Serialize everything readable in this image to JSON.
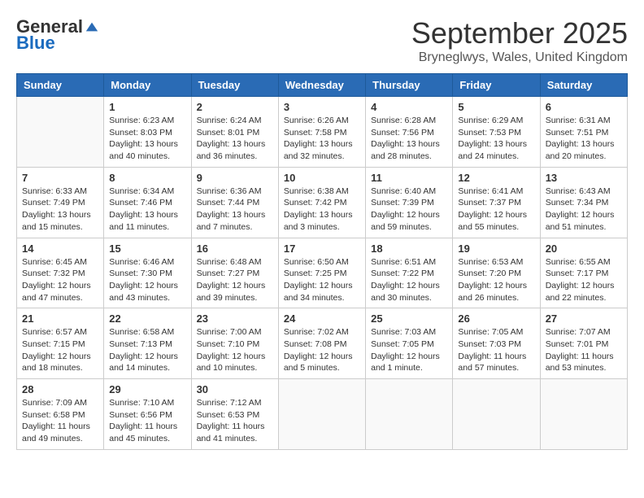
{
  "header": {
    "logo": {
      "general": "General",
      "blue": "Blue"
    },
    "title": "September 2025",
    "location": "Bryneglwys, Wales, United Kingdom"
  },
  "days_of_week": [
    "Sunday",
    "Monday",
    "Tuesday",
    "Wednesday",
    "Thursday",
    "Friday",
    "Saturday"
  ],
  "weeks": [
    [
      {
        "day": "",
        "sunrise": "",
        "sunset": "",
        "daylight": ""
      },
      {
        "day": "1",
        "sunrise": "Sunrise: 6:23 AM",
        "sunset": "Sunset: 8:03 PM",
        "daylight": "Daylight: 13 hours and 40 minutes."
      },
      {
        "day": "2",
        "sunrise": "Sunrise: 6:24 AM",
        "sunset": "Sunset: 8:01 PM",
        "daylight": "Daylight: 13 hours and 36 minutes."
      },
      {
        "day": "3",
        "sunrise": "Sunrise: 6:26 AM",
        "sunset": "Sunset: 7:58 PM",
        "daylight": "Daylight: 13 hours and 32 minutes."
      },
      {
        "day": "4",
        "sunrise": "Sunrise: 6:28 AM",
        "sunset": "Sunset: 7:56 PM",
        "daylight": "Daylight: 13 hours and 28 minutes."
      },
      {
        "day": "5",
        "sunrise": "Sunrise: 6:29 AM",
        "sunset": "Sunset: 7:53 PM",
        "daylight": "Daylight: 13 hours and 24 minutes."
      },
      {
        "day": "6",
        "sunrise": "Sunrise: 6:31 AM",
        "sunset": "Sunset: 7:51 PM",
        "daylight": "Daylight: 13 hours and 20 minutes."
      }
    ],
    [
      {
        "day": "7",
        "sunrise": "Sunrise: 6:33 AM",
        "sunset": "Sunset: 7:49 PM",
        "daylight": "Daylight: 13 hours and 15 minutes."
      },
      {
        "day": "8",
        "sunrise": "Sunrise: 6:34 AM",
        "sunset": "Sunset: 7:46 PM",
        "daylight": "Daylight: 13 hours and 11 minutes."
      },
      {
        "day": "9",
        "sunrise": "Sunrise: 6:36 AM",
        "sunset": "Sunset: 7:44 PM",
        "daylight": "Daylight: 13 hours and 7 minutes."
      },
      {
        "day": "10",
        "sunrise": "Sunrise: 6:38 AM",
        "sunset": "Sunset: 7:42 PM",
        "daylight": "Daylight: 13 hours and 3 minutes."
      },
      {
        "day": "11",
        "sunrise": "Sunrise: 6:40 AM",
        "sunset": "Sunset: 7:39 PM",
        "daylight": "Daylight: 12 hours and 59 minutes."
      },
      {
        "day": "12",
        "sunrise": "Sunrise: 6:41 AM",
        "sunset": "Sunset: 7:37 PM",
        "daylight": "Daylight: 12 hours and 55 minutes."
      },
      {
        "day": "13",
        "sunrise": "Sunrise: 6:43 AM",
        "sunset": "Sunset: 7:34 PM",
        "daylight": "Daylight: 12 hours and 51 minutes."
      }
    ],
    [
      {
        "day": "14",
        "sunrise": "Sunrise: 6:45 AM",
        "sunset": "Sunset: 7:32 PM",
        "daylight": "Daylight: 12 hours and 47 minutes."
      },
      {
        "day": "15",
        "sunrise": "Sunrise: 6:46 AM",
        "sunset": "Sunset: 7:30 PM",
        "daylight": "Daylight: 12 hours and 43 minutes."
      },
      {
        "day": "16",
        "sunrise": "Sunrise: 6:48 AM",
        "sunset": "Sunset: 7:27 PM",
        "daylight": "Daylight: 12 hours and 39 minutes."
      },
      {
        "day": "17",
        "sunrise": "Sunrise: 6:50 AM",
        "sunset": "Sunset: 7:25 PM",
        "daylight": "Daylight: 12 hours and 34 minutes."
      },
      {
        "day": "18",
        "sunrise": "Sunrise: 6:51 AM",
        "sunset": "Sunset: 7:22 PM",
        "daylight": "Daylight: 12 hours and 30 minutes."
      },
      {
        "day": "19",
        "sunrise": "Sunrise: 6:53 AM",
        "sunset": "Sunset: 7:20 PM",
        "daylight": "Daylight: 12 hours and 26 minutes."
      },
      {
        "day": "20",
        "sunrise": "Sunrise: 6:55 AM",
        "sunset": "Sunset: 7:17 PM",
        "daylight": "Daylight: 12 hours and 22 minutes."
      }
    ],
    [
      {
        "day": "21",
        "sunrise": "Sunrise: 6:57 AM",
        "sunset": "Sunset: 7:15 PM",
        "daylight": "Daylight: 12 hours and 18 minutes."
      },
      {
        "day": "22",
        "sunrise": "Sunrise: 6:58 AM",
        "sunset": "Sunset: 7:13 PM",
        "daylight": "Daylight: 12 hours and 14 minutes."
      },
      {
        "day": "23",
        "sunrise": "Sunrise: 7:00 AM",
        "sunset": "Sunset: 7:10 PM",
        "daylight": "Daylight: 12 hours and 10 minutes."
      },
      {
        "day": "24",
        "sunrise": "Sunrise: 7:02 AM",
        "sunset": "Sunset: 7:08 PM",
        "daylight": "Daylight: 12 hours and 5 minutes."
      },
      {
        "day": "25",
        "sunrise": "Sunrise: 7:03 AM",
        "sunset": "Sunset: 7:05 PM",
        "daylight": "Daylight: 12 hours and 1 minute."
      },
      {
        "day": "26",
        "sunrise": "Sunrise: 7:05 AM",
        "sunset": "Sunset: 7:03 PM",
        "daylight": "Daylight: 11 hours and 57 minutes."
      },
      {
        "day": "27",
        "sunrise": "Sunrise: 7:07 AM",
        "sunset": "Sunset: 7:01 PM",
        "daylight": "Daylight: 11 hours and 53 minutes."
      }
    ],
    [
      {
        "day": "28",
        "sunrise": "Sunrise: 7:09 AM",
        "sunset": "Sunset: 6:58 PM",
        "daylight": "Daylight: 11 hours and 49 minutes."
      },
      {
        "day": "29",
        "sunrise": "Sunrise: 7:10 AM",
        "sunset": "Sunset: 6:56 PM",
        "daylight": "Daylight: 11 hours and 45 minutes."
      },
      {
        "day": "30",
        "sunrise": "Sunrise: 7:12 AM",
        "sunset": "Sunset: 6:53 PM",
        "daylight": "Daylight: 11 hours and 41 minutes."
      },
      {
        "day": "",
        "sunrise": "",
        "sunset": "",
        "daylight": ""
      },
      {
        "day": "",
        "sunrise": "",
        "sunset": "",
        "daylight": ""
      },
      {
        "day": "",
        "sunrise": "",
        "sunset": "",
        "daylight": ""
      },
      {
        "day": "",
        "sunrise": "",
        "sunset": "",
        "daylight": ""
      }
    ]
  ]
}
